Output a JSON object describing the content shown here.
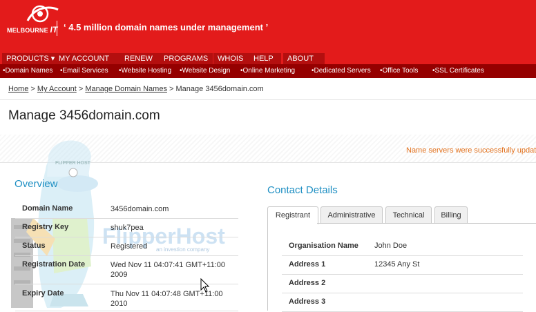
{
  "brand": {
    "logo_small": "MELBOURNE",
    "logo_big": "IT",
    "tagline": "‘ 4.5 million domain names under management ’"
  },
  "nav": [
    "PRODUCTS",
    "MY ACCOUNT",
    "RENEW",
    "PROGRAMS",
    "WHOIS",
    "HELP",
    "ABOUT"
  ],
  "subnav": [
    "•Domain Names",
    "•Email Services",
    "•Website Hosting",
    "•Website Design",
    "•Online Marketing",
    "•Dedicated Servers",
    "•Office Tools",
    "•SSL Certificates"
  ],
  "breadcrumb": {
    "home": "Home",
    "account": "My Account",
    "manage": "Manage Domain Names",
    "current": "Manage 3456domain.com",
    "sep": ">"
  },
  "page_title": "Manage 3456domain.com",
  "message": "Name servers were successfully update",
  "overview": {
    "title": "Overview",
    "rows": [
      {
        "label": "Domain Name",
        "value": "3456domain.com"
      },
      {
        "label": "Registry Key",
        "value": "shuk7pea"
      },
      {
        "label": "Status",
        "value": "Registered"
      },
      {
        "label": "Registration Date",
        "value": "Wed Nov 11 04:07:41 GMT+11:00 2009"
      },
      {
        "label": "Expiry Date",
        "value": "Thu Nov 11 04:07:48 GMT+11:00 2010"
      }
    ]
  },
  "contact": {
    "title": "Contact Details",
    "tabs": [
      "Registrant",
      "Administrative",
      "Technical",
      "Billing"
    ],
    "active_tab": "Registrant",
    "rows": [
      {
        "label": "Organisation Name",
        "value": "John Doe"
      },
      {
        "label": "Address 1",
        "value": "12345 Any St"
      },
      {
        "label": "Address 2",
        "value": ""
      },
      {
        "label": "Address 3",
        "value": ""
      }
    ]
  },
  "watermark": {
    "brand": "FlipperHost",
    "sub": "an investion company",
    "cap": "FLIPPER HOST"
  },
  "colors": {
    "header_red": "#e31b1b",
    "subnav_dark": "#950000",
    "accent_blue": "#1e8fc3",
    "success_orange": "#e2711d"
  }
}
